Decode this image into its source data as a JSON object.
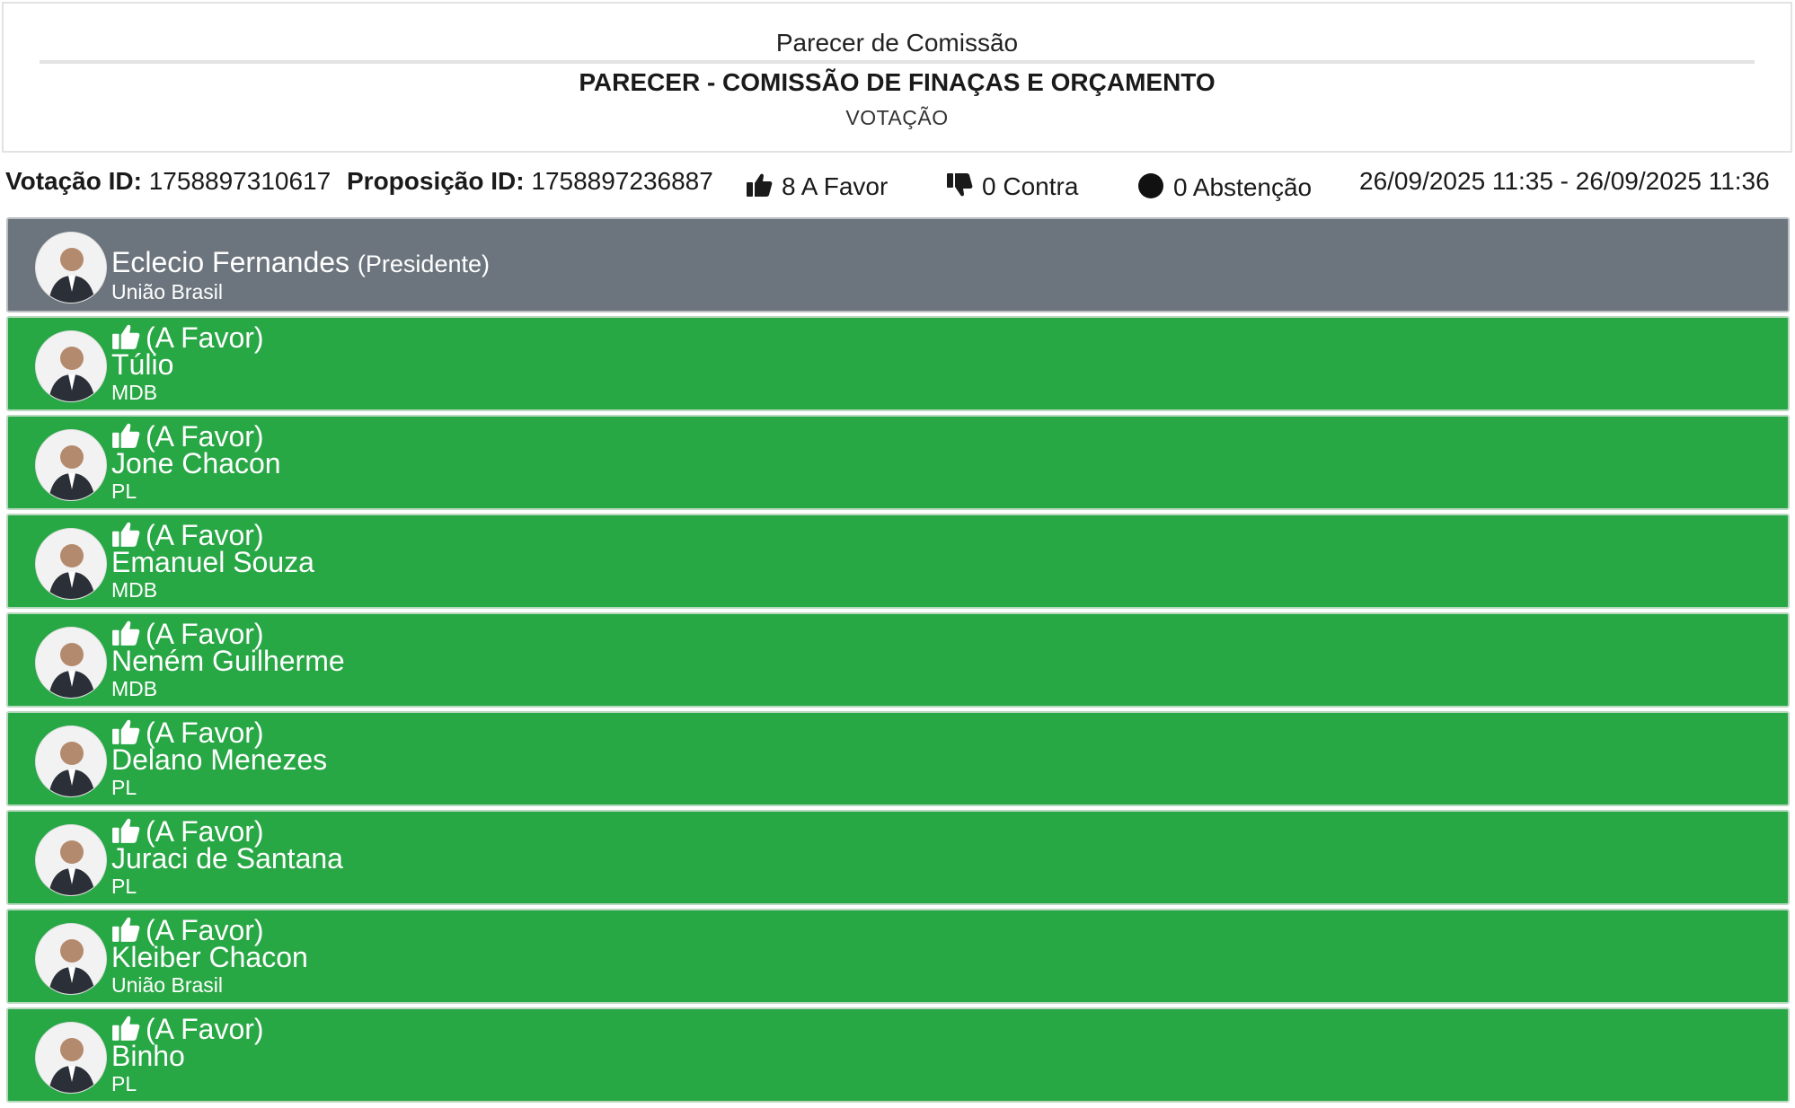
{
  "header": {
    "subtitle": "Parecer de Comissão",
    "title": "PARECER - COMISSÃO DE FINAÇAS E ORÇAMENTO",
    "phase": "VOTAÇÃO"
  },
  "info": {
    "votacao_label": "Votação ID:",
    "votacao_id": "1758897310617",
    "proposicao_label": "Proposição ID:",
    "proposicao_id": "1758897236887",
    "favor_text": "8 A Favor",
    "contra_text": "0 Contra",
    "abstencao_text": "0 Abstenção",
    "periodo": "26/09/2025 11:35 - 26/09/2025 11:36"
  },
  "president": {
    "name": "Eclecio Fernandes",
    "role": "(Presidente)",
    "party": "União Brasil"
  },
  "members": [
    {
      "vote": "(A Favor)",
      "name": "Túlio",
      "party": "MDB"
    },
    {
      "vote": "(A Favor)",
      "name": "Jone Chacon",
      "party": "PL"
    },
    {
      "vote": "(A Favor)",
      "name": "Emanuel Souza",
      "party": "MDB"
    },
    {
      "vote": "(A Favor)",
      "name": "Neném Guilherme",
      "party": "MDB"
    },
    {
      "vote": "(A Favor)",
      "name": "Delano Menezes",
      "party": "PL"
    },
    {
      "vote": "(A Favor)",
      "name": "Juraci de Santana",
      "party": "PL"
    },
    {
      "vote": "(A Favor)",
      "name": "Kleiber Chacon",
      "party": "União Brasil"
    },
    {
      "vote": "(A Favor)",
      "name": "Binho",
      "party": "PL"
    }
  ],
  "colors": {
    "favor": "#28a745",
    "president": "#6c757d"
  },
  "icons": {
    "favor": "thumbs-up-icon",
    "contra": "thumbs-down-icon",
    "abstencao": "circle-icon"
  }
}
